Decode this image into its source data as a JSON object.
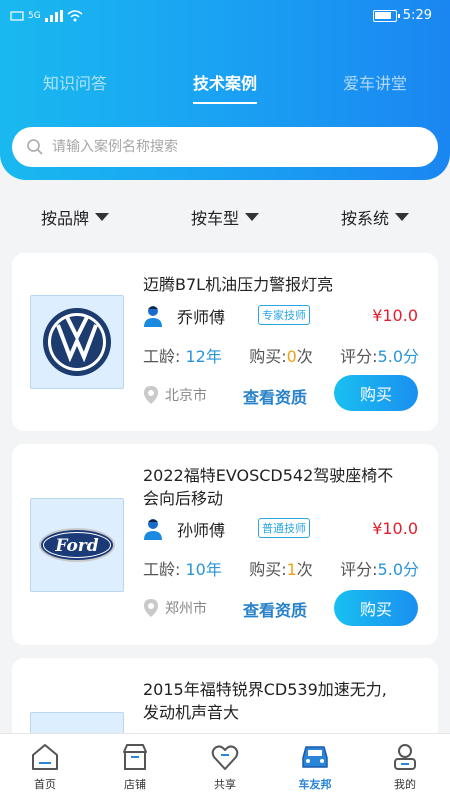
{
  "status_bar": {
    "signal_text": "5G",
    "time": "5:29"
  },
  "tabs": [
    {
      "label": "知识问答"
    },
    {
      "label": "技术案例"
    },
    {
      "label": "爱车讲堂"
    }
  ],
  "search": {
    "placeholder": "请输入案例名称搜索"
  },
  "filters": [
    {
      "label": "按品牌"
    },
    {
      "label": "按车型"
    },
    {
      "label": "按系统"
    }
  ],
  "cards": [
    {
      "logo": "volkswagen-logo",
      "title": "迈腾B7L机油压力警报灯亮",
      "technician": "乔师傅",
      "badge": "专家技师",
      "price": "¥10.0",
      "age_label": "工龄:",
      "age_value": "12年",
      "buy_label": "购买:",
      "buy_count": "0",
      "buy_unit": "次",
      "score_label": "评分:",
      "score_value": "5.0分",
      "city": "北京市",
      "view_label": "查看资质",
      "buy_button": "购买"
    },
    {
      "logo": "ford-logo",
      "title_line1": "2022福特EVOSCD542驾驶座椅不",
      "title_line2": "会向后移动",
      "technician": "孙师傅",
      "badge": "普通技师",
      "price": "¥10.0",
      "age_label": "工龄:",
      "age_value": "10年",
      "buy_label": "购买:",
      "buy_count": "1",
      "buy_unit": "次",
      "score_label": "评分:",
      "score_value": "5.0分",
      "city": "郑州市",
      "view_label": "查看资质",
      "buy_button": "购买"
    },
    {
      "title_line1": "2015年福特锐界CD539加速无力,",
      "title_line2": "发动机声音大"
    }
  ],
  "bottom_nav": [
    {
      "label": "首页",
      "icon": "home-icon"
    },
    {
      "label": "店铺",
      "icon": "store-icon"
    },
    {
      "label": "共享",
      "icon": "share-heart-icon"
    },
    {
      "label": "车友邦",
      "icon": "car-icon"
    },
    {
      "label": "我的",
      "icon": "profile-icon"
    }
  ],
  "colors": {
    "header_gradient_start": "#19b9f0",
    "header_gradient_end": "#1a86f1",
    "price": "#e0202e",
    "accent_blue": "#2782c9"
  }
}
